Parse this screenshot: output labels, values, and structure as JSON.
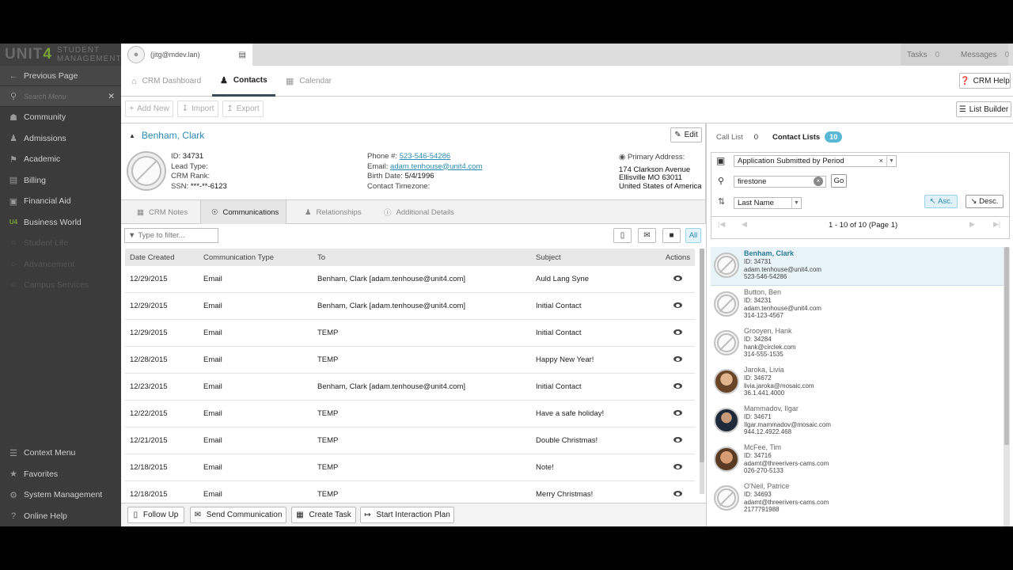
{
  "brand": {
    "unit": "UNIT",
    "four": "4",
    "student": "STUDENT",
    "management": "MANAGEMENT"
  },
  "sidebar": {
    "previous_page": "Previous Page",
    "search_placeholder": "Search Menu",
    "items": [
      {
        "label": "Community",
        "icon": "community-icon",
        "enabled": true
      },
      {
        "label": "Admissions",
        "icon": "admissions-icon",
        "enabled": true
      },
      {
        "label": "Academic",
        "icon": "academic-icon",
        "enabled": true
      },
      {
        "label": "Billing",
        "icon": "billing-icon",
        "enabled": true
      },
      {
        "label": "Financial Aid",
        "icon": "financial-aid-icon",
        "enabled": true
      },
      {
        "label": "Business World",
        "icon": "business-world-icon",
        "enabled": true
      },
      {
        "label": "Student Life",
        "icon": "student-life-icon",
        "enabled": false
      },
      {
        "label": "Advancement",
        "icon": "advancement-icon",
        "enabled": false
      },
      {
        "label": "Campus Services",
        "icon": "campus-services-icon",
        "enabled": false
      }
    ],
    "bottom": [
      {
        "label": "Context Menu",
        "icon": "context-menu-icon"
      },
      {
        "label": "Favorites",
        "icon": "star-icon"
      },
      {
        "label": "System Management",
        "icon": "gear-icon"
      },
      {
        "label": "Online Help",
        "icon": "help-icon"
      }
    ]
  },
  "topbar": {
    "user": "(jitg@mdev.lan)",
    "tasks_label": "Tasks",
    "tasks_count": "0",
    "messages_label": "Messages",
    "messages_count": "0"
  },
  "tabs": [
    {
      "label": "CRM Dashboard"
    },
    {
      "label": "Contacts"
    },
    {
      "label": "Calendar"
    }
  ],
  "help_button": "CRM Help",
  "toolbar": {
    "add_new": "Add New",
    "import": "Import",
    "export": "Export",
    "list_builder": "List Builder"
  },
  "contact": {
    "name": "Benham, Clark",
    "edit": "Edit",
    "id_label": "ID:",
    "id": "34731",
    "lead_type_label": "Lead Type:",
    "crm_rank_label": "CRM Rank:",
    "ssn_label": "SSN:",
    "ssn": "***-**-6123",
    "phone_label": "Phone #:",
    "phone": "523-546-54286",
    "email_label": "Email:",
    "email": "adam.tenhouse@unit4.com",
    "birth_label": "Birth Date:",
    "birth": "5/4/1996",
    "tz_label": "Contact Timezone:",
    "address_label": "Primary Address:",
    "address1": "174 Clarkson Avenue",
    "address2": "Ellisville MO 63011",
    "address3": "United States of America"
  },
  "subtabs": [
    {
      "label": "CRM Notes"
    },
    {
      "label": "Communications"
    },
    {
      "label": "Relationships"
    },
    {
      "label": "Additional Details"
    }
  ],
  "filter": {
    "placeholder": "Type to filter...",
    "all": "All"
  },
  "table": {
    "headers": [
      "Date Created",
      "Communication Type",
      "To",
      "Subject",
      "Actions"
    ],
    "rows": [
      [
        "12/29/2015",
        "Email",
        "Benham, Clark [adam.tenhouse@unit4.com]",
        "Auld Lang Syne"
      ],
      [
        "12/29/2015",
        "Email",
        "Benham, Clark [adam.tenhouse@unit4.com]",
        "Initial Contact"
      ],
      [
        "12/29/2015",
        "Email",
        "TEMP",
        "Initial Contact"
      ],
      [
        "12/28/2015",
        "Email",
        "TEMP",
        "Happy New Year!"
      ],
      [
        "12/23/2015",
        "Email",
        "Benham, Clark [adam.tenhouse@unit4.com]",
        "Initial Contact"
      ],
      [
        "12/22/2015",
        "Email",
        "TEMP",
        "Have a safe holiday!"
      ],
      [
        "12/21/2015",
        "Email",
        "TEMP",
        "Double Christmas!"
      ],
      [
        "12/18/2015",
        "Email",
        "TEMP",
        "Note!"
      ],
      [
        "12/18/2015",
        "Email",
        "TEMP",
        "Merry Christmas!"
      ]
    ]
  },
  "actions": {
    "follow_up": "Follow Up",
    "send": "Send Communication",
    "task": "Create Task",
    "plan": "Start Interaction Plan"
  },
  "right": {
    "call_list": "Call List",
    "call_count": "0",
    "contact_lists": "Contact Lists",
    "contact_count": "10",
    "list_select": "Application Submitted by Period",
    "search_value": "firestone",
    "go": "Go",
    "sort_select": "Last Name",
    "asc": "Asc.",
    "desc": "Desc.",
    "page_info": "1 - 10 of 10 (Page 1)",
    "contacts": [
      {
        "name": "Benham, Clark",
        "id": "ID: 34731",
        "email": "adam.tenhouse@unit4.com",
        "phone": "523-546-54286",
        "photo": "none"
      },
      {
        "name": "Button, Ben",
        "id": "ID: 34231",
        "email": "adam.tenhouse@unit4.com",
        "phone": "314-123-4567",
        "photo": "none"
      },
      {
        "name": "Grooyen, Hank",
        "id": "ID: 34284",
        "email": "hank@circlek.com",
        "phone": "314-555-1535",
        "photo": "none"
      },
      {
        "name": "Jaroka, Livia",
        "id": "ID: 34672",
        "email": "livia.jaroka@mosaic.com",
        "phone": "36.1.441.4000",
        "photo": "photo1"
      },
      {
        "name": "Mammadov, Ilgar",
        "id": "ID: 34671",
        "email": "Ilgar.mammadov@mosaic.com",
        "phone": "944.12.4922.468",
        "photo": "photo2"
      },
      {
        "name": "McFee, Tim",
        "id": "ID: 34716",
        "email": "adamt@threerivers-cams.com",
        "phone": "026-270-5133",
        "photo": "photo3"
      },
      {
        "name": "O'Neil, Patrice",
        "id": "ID: 34693",
        "email": "adamt@threerivers-cams.com",
        "phone": "2177791988",
        "photo": "none"
      }
    ]
  }
}
